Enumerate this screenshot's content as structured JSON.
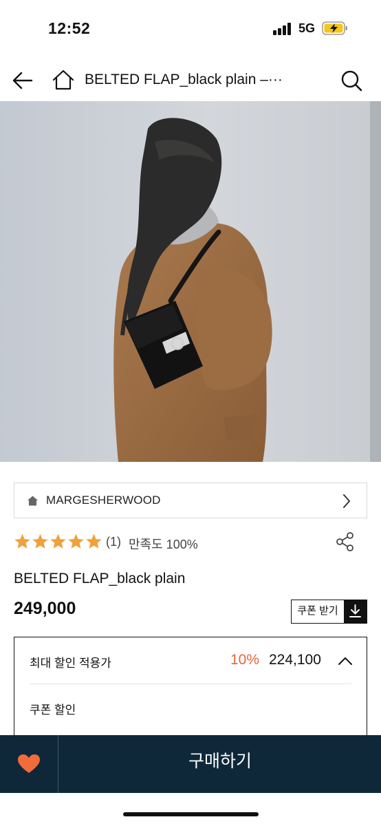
{
  "status_bar": {
    "time": "12:52",
    "network": "5G",
    "signal_icon": "cellular-signal-icon",
    "battery_icon": "battery-charging-icon"
  },
  "nav": {
    "back_icon": "back-arrow-icon",
    "home_icon": "home-icon",
    "title": "BELTED FLAP_black plain –···",
    "search_icon": "search-icon"
  },
  "hero": {
    "image": "product-photo"
  },
  "brand": {
    "icon": "home-icon",
    "name": "MARGESHERWOOD",
    "chevron_icon": "chevron-right-icon"
  },
  "rating": {
    "stars": 5,
    "count": "(1)",
    "satisfaction": "만족도 100%",
    "share_icon": "share-icon",
    "star_color": "#f0a13c"
  },
  "product": {
    "name": "BELTED FLAP_black plain",
    "price": "249,000"
  },
  "coupon_button": {
    "label": "쿠폰 받기",
    "icon": "download-icon"
  },
  "discount": {
    "label": "최대 할인 적용가",
    "rate": "10%",
    "price": "224,100",
    "toggle_icon": "chevron-up-icon",
    "coupon_label": "쿠폰 할인",
    "rate_color": "#e8643a"
  },
  "bottom_bar": {
    "wish_icon": "heart-icon",
    "buy_label": "구매하기",
    "background": "#0f2839",
    "heart_color": "#f26b3a"
  }
}
